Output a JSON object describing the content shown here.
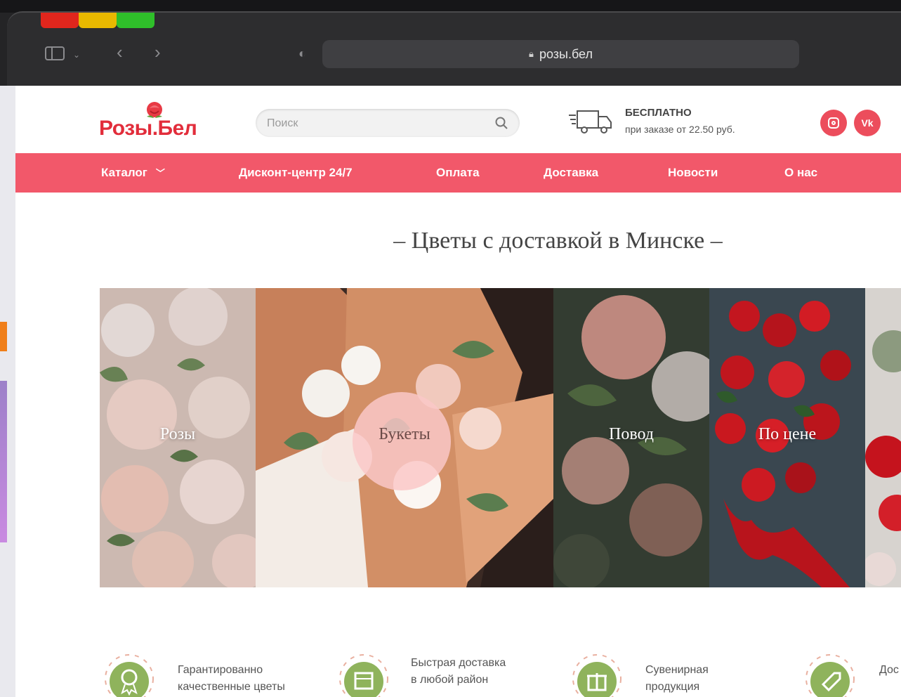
{
  "browser": {
    "url": "розы.бел",
    "colors": {
      "red": "#e0261d",
      "yellow": "#e8b800",
      "green": "#2fbf2a"
    }
  },
  "header": {
    "logo_text": "Розы.Бел",
    "search_placeholder": "Поиск",
    "delivery_title": "БЕСПЛАТНО",
    "delivery_subtitle": "при заказе от 22.50 руб.",
    "social": {
      "vk_label": "Vk"
    }
  },
  "nav": {
    "items": [
      {
        "label": "Каталог"
      },
      {
        "label": "Дисконт-центр 24/7"
      },
      {
        "label": "Оплата"
      },
      {
        "label": "Доставка"
      },
      {
        "label": "Новости"
      },
      {
        "label": "О нас"
      }
    ]
  },
  "main": {
    "title": "– Цветы с доставкой в Минске –",
    "categories": [
      {
        "label": "Розы"
      },
      {
        "label": "Букеты"
      },
      {
        "label": "Повод"
      },
      {
        "label": "По цене"
      }
    ]
  },
  "features": [
    {
      "line1": "Гарантированно",
      "line2": "качественные цветы"
    },
    {
      "line1": "Быстрая доставка",
      "line2": "в любой район"
    },
    {
      "line1": "Сувенирная",
      "line2": "продукция"
    },
    {
      "line1": "Дос"
    }
  ],
  "colors": {
    "brand": "#e22d3b",
    "nav": "#f2586a",
    "feature_green": "#8fb35c"
  }
}
